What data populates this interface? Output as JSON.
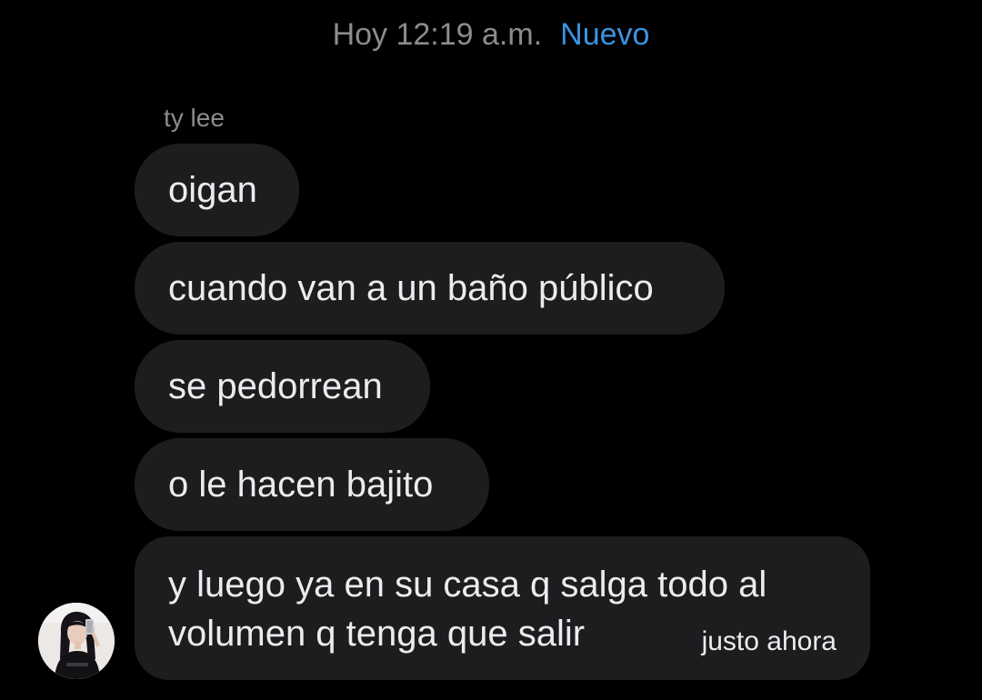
{
  "header": {
    "date": "Hoy 12:19 a.m.",
    "new_label": "Nuevo"
  },
  "sender": {
    "name": "ty lee"
  },
  "messages": [
    {
      "lines": [
        "oigan"
      ]
    },
    {
      "lines": [
        "cuando van a un baño público"
      ]
    },
    {
      "lines": [
        "se pedorrean"
      ]
    },
    {
      "lines": [
        "o le hacen bajito"
      ]
    },
    {
      "lines": [
        "y luego ya en su casa q salga todo al",
        "volumen q tenga que salir"
      ],
      "timestamp": "justo ahora"
    }
  ],
  "colors": {
    "background": "#000000",
    "bubble": "#1d1d20",
    "text": "#ececee",
    "muted": "#8b8b90",
    "accent": "#3b93e0"
  }
}
